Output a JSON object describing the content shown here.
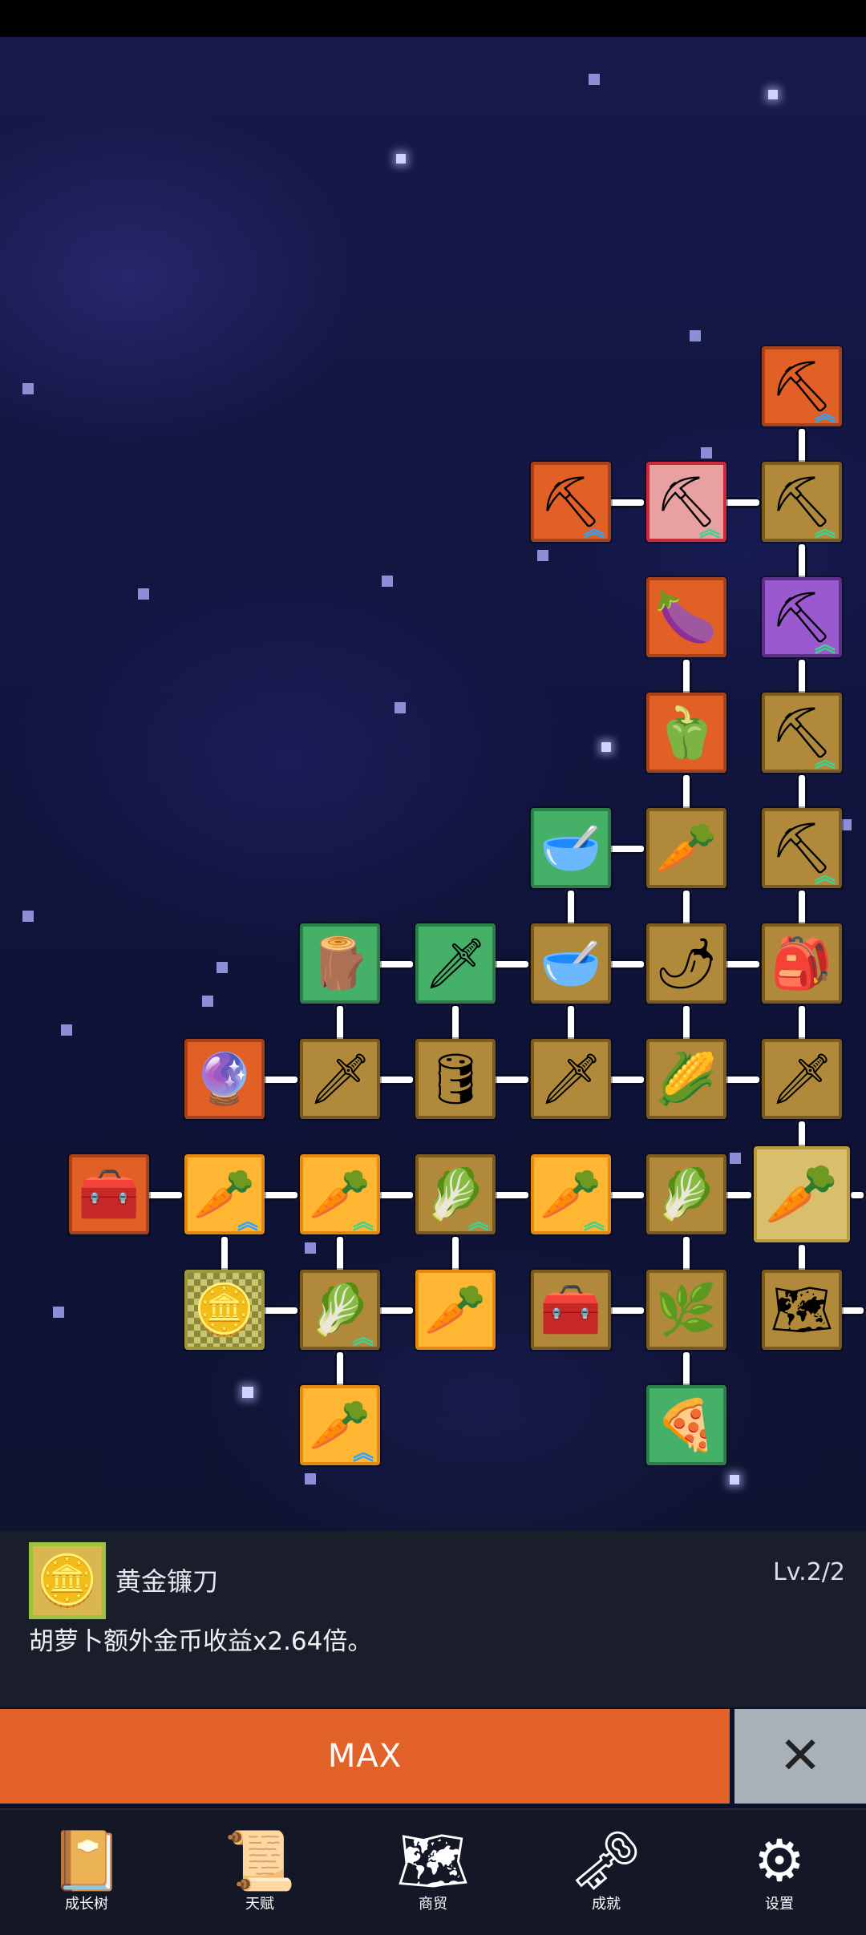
{
  "tree": {
    "nodes": [
      {
        "name": "shovel",
        "icon": "⛏",
        "style": "orange",
        "boost": "blue"
      },
      {
        "name": "shovel",
        "icon": "⛏",
        "style": "orange",
        "boost": "blue"
      },
      {
        "name": "shovel",
        "icon": "⛏",
        "style": "pink",
        "boost": "green"
      },
      {
        "name": "shovel",
        "icon": "⛏",
        "style": "gold",
        "boost": "green"
      },
      {
        "name": "eggplant",
        "icon": "🍆",
        "style": "orange",
        "boost": ""
      },
      {
        "name": "shovel",
        "icon": "⛏",
        "style": "purple",
        "boost": "green"
      },
      {
        "name": "bell-pepper",
        "icon": "🫑",
        "style": "orange",
        "boost": ""
      },
      {
        "name": "shovel",
        "icon": "⛏",
        "style": "gold",
        "boost": "green"
      },
      {
        "name": "soup-bowl",
        "icon": "🥣",
        "style": "green",
        "boost": ""
      },
      {
        "name": "daikon",
        "icon": "🥕",
        "style": "gold",
        "boost": ""
      },
      {
        "name": "shovel",
        "icon": "⛏",
        "style": "gold",
        "boost": "green"
      },
      {
        "name": "wood-planks",
        "icon": "🪵",
        "style": "green",
        "boost": ""
      },
      {
        "name": "golden-sword",
        "icon": "🗡",
        "style": "green",
        "boost": ""
      },
      {
        "name": "bowl",
        "icon": "🥣",
        "style": "gold",
        "boost": ""
      },
      {
        "name": "chili",
        "icon": "🌶",
        "style": "gold",
        "boost": ""
      },
      {
        "name": "sack",
        "icon": "🎒",
        "style": "gold",
        "boost": ""
      },
      {
        "name": "scepter",
        "icon": "🔮",
        "style": "orange",
        "boost": ""
      },
      {
        "name": "sword",
        "icon": "🗡",
        "style": "gold",
        "boost": ""
      },
      {
        "name": "barrel",
        "icon": "🛢",
        "style": "gold",
        "boost": ""
      },
      {
        "name": "sword",
        "icon": "🗡",
        "style": "gold",
        "boost": ""
      },
      {
        "name": "corn",
        "icon": "🌽",
        "style": "gold",
        "boost": ""
      },
      {
        "name": "spear",
        "icon": "🗡",
        "style": "gold",
        "boost": ""
      },
      {
        "name": "chest",
        "icon": "🧰",
        "style": "orange",
        "boost": ""
      },
      {
        "name": "carrot",
        "icon": "🥕",
        "style": "bright",
        "boost": "blue"
      },
      {
        "name": "carrot",
        "icon": "🥕",
        "style": "bright",
        "boost": "green"
      },
      {
        "name": "cabbage",
        "icon": "🥬",
        "style": "gold",
        "boost": "green"
      },
      {
        "name": "carrot",
        "icon": "🥕",
        "style": "bright",
        "boost": "green"
      },
      {
        "name": "cabbage",
        "icon": "🥬",
        "style": "gold",
        "boost": ""
      },
      {
        "name": "carrot-root",
        "icon": "🥕",
        "style": "cream",
        "boost": ""
      },
      {
        "name": "gold-coin",
        "icon": "🪙",
        "style": "check",
        "boost": ""
      },
      {
        "name": "cabbage",
        "icon": "🥬",
        "style": "gold",
        "boost": "green"
      },
      {
        "name": "carrot",
        "icon": "🥕",
        "style": "bright",
        "boost": ""
      },
      {
        "name": "treasure-chest",
        "icon": "🧰",
        "style": "gold",
        "boost": ""
      },
      {
        "name": "leek",
        "icon": "🌿",
        "style": "gold",
        "boost": ""
      },
      {
        "name": "map",
        "icon": "🗺",
        "style": "gold",
        "boost": ""
      },
      {
        "name": "carrot",
        "icon": "🥕",
        "style": "bright",
        "boost": "blue"
      },
      {
        "name": "pizza",
        "icon": "🍕",
        "style": "green",
        "boost": ""
      }
    ]
  },
  "info_panel": {
    "icon": "🪙",
    "icon_name": "gold-coin-icon",
    "item_name": "黄金镰刀",
    "level": "Lv.2/2",
    "description": "胡萝卜额外金币收益x2.64倍。"
  },
  "actions": {
    "max_label": "MAX",
    "close_icon": "✕"
  },
  "nav": [
    {
      "label": "成长树",
      "icon": "📔"
    },
    {
      "label": "天赋",
      "icon": "📜"
    },
    {
      "label": "商贸",
      "icon": "🗺"
    },
    {
      "label": "成就",
      "icon": "🗝"
    },
    {
      "label": "设置",
      "icon": "⚙"
    }
  ],
  "colors": {
    "accent_orange": "#e2622a",
    "close_gray": "#a8b0b8",
    "panel_bg": "#1a1e2b",
    "boost_blue": "#26a4ff",
    "boost_green": "#40d090"
  }
}
